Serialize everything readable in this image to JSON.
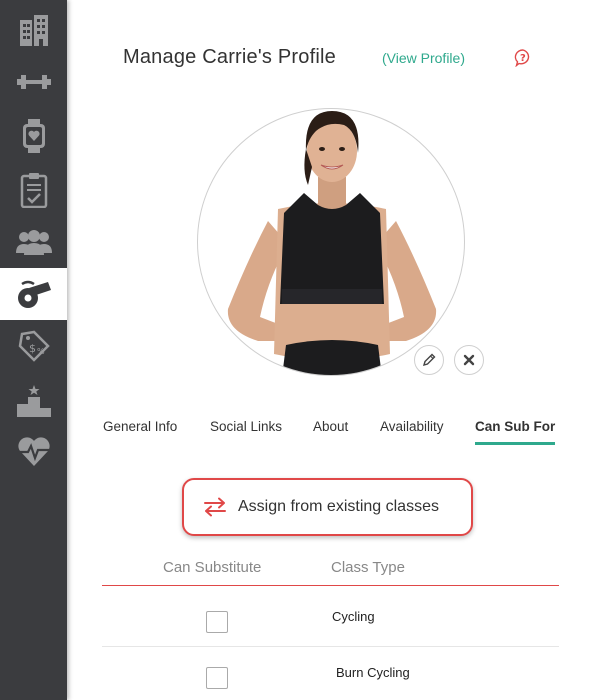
{
  "header": {
    "title": "Manage Carrie's Profile",
    "view_profile": "(View Profile)",
    "help_icon": "question-bubble-icon"
  },
  "sidebar": {
    "items": [
      {
        "icon": "building-icon"
      },
      {
        "icon": "dumbbell-icon"
      },
      {
        "icon": "smartwatch-heart-icon"
      },
      {
        "icon": "clipboard-check-icon"
      },
      {
        "icon": "group-icon"
      },
      {
        "icon": "whistle-icon",
        "active": true
      },
      {
        "icon": "money-tag-icon"
      },
      {
        "icon": "podium-icon"
      },
      {
        "icon": "heart-pulse-icon"
      }
    ]
  },
  "tabs": [
    {
      "label": "General Info"
    },
    {
      "label": "Social Links"
    },
    {
      "label": "About"
    },
    {
      "label": "Availability"
    },
    {
      "label": "Can Sub For",
      "active": true
    }
  ],
  "assign_button": {
    "label": "Assign from existing classes",
    "icon": "swap-arrows-icon"
  },
  "table": {
    "headers": [
      "Can Substitute",
      "Class Type"
    ],
    "rows": [
      {
        "class_type": "Cycling",
        "checked": false
      },
      {
        "class_type": "Burn Cycling",
        "checked": false
      }
    ]
  },
  "colors": {
    "sidebar_bg": "#3b3c3f",
    "accent_teal": "#2fa98d",
    "accent_red": "#e04848"
  }
}
